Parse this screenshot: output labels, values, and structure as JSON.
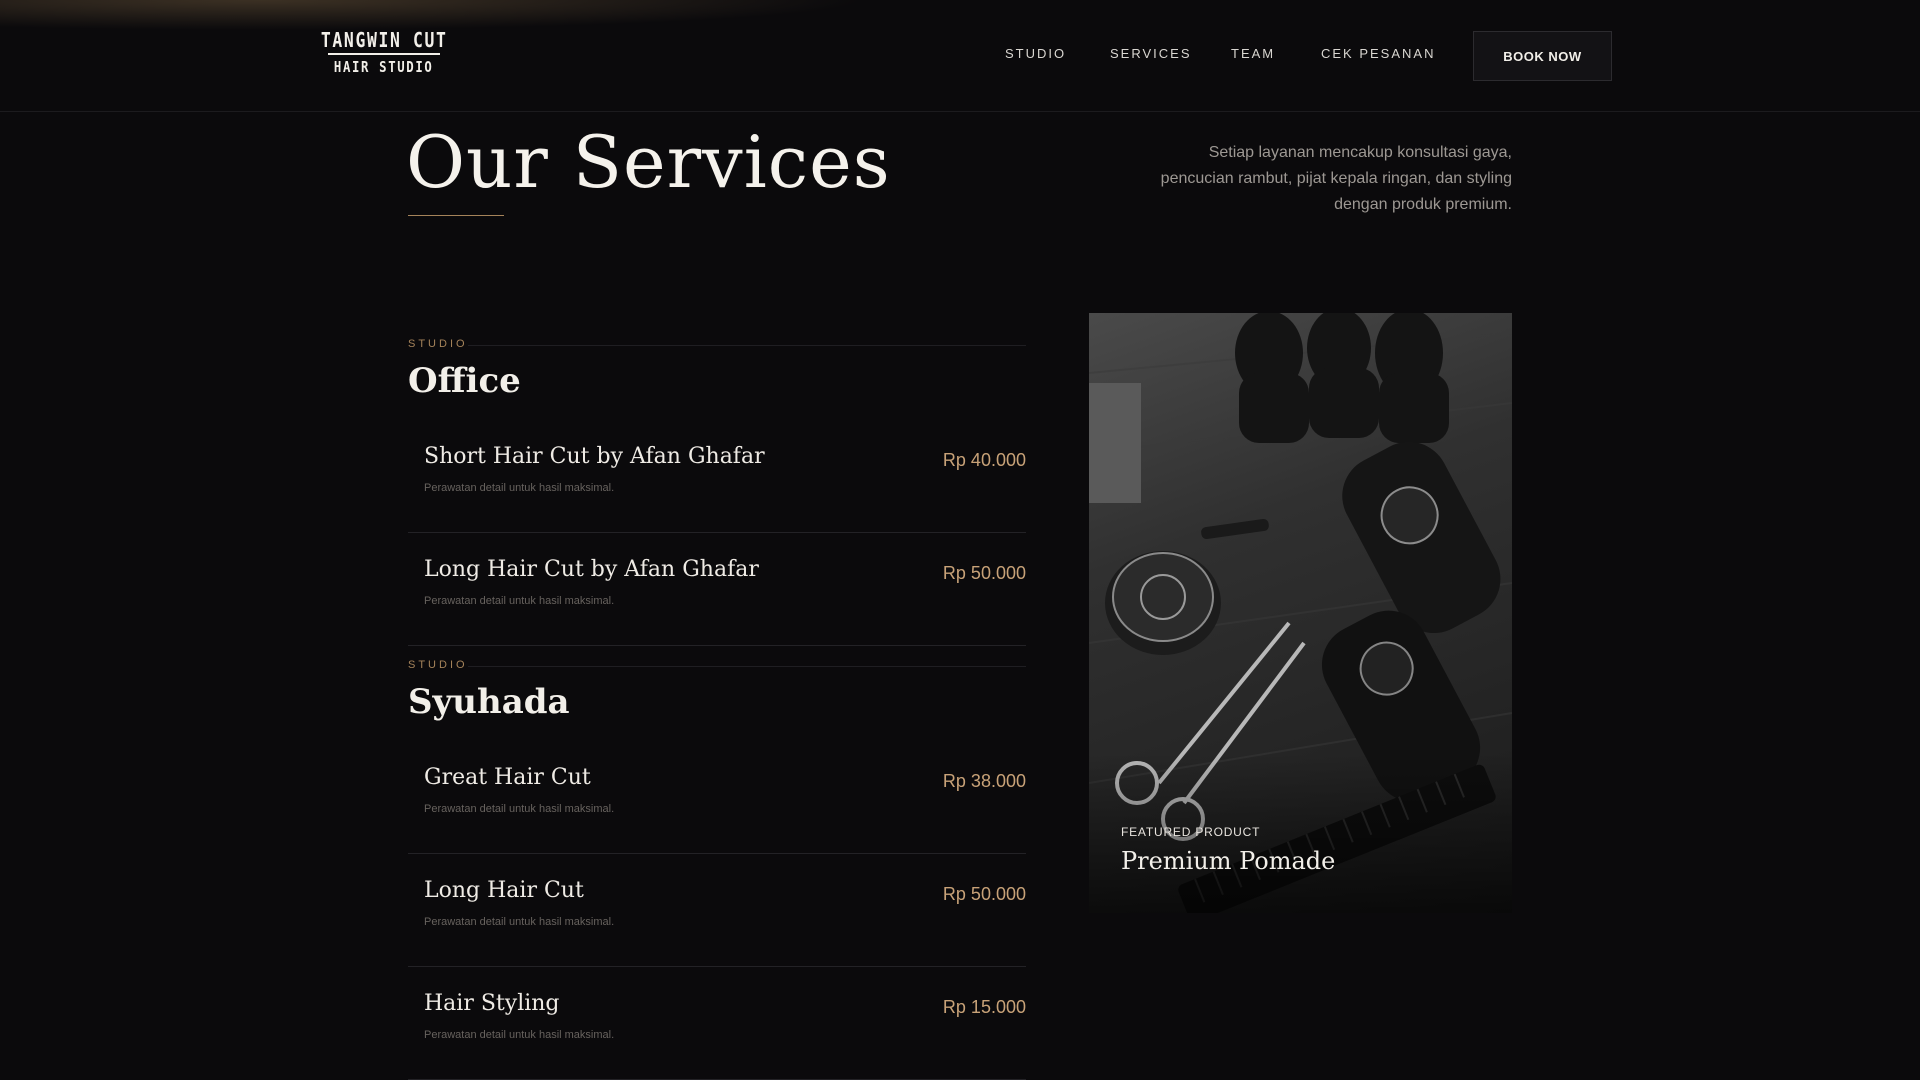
{
  "brand": {
    "line1": "TANGWIN CUT",
    "line2": "HAIR STUDIO"
  },
  "nav": {
    "items": [
      "STUDIO",
      "SERVICES",
      "TEAM",
      "CEK PESANAN"
    ],
    "cta": "BOOK NOW"
  },
  "hero": {
    "title": "Our Services",
    "intro_lines": [
      "Setiap layanan mencakup konsultasi gaya,",
      "pencucian rambut, pijat kepala ringan, dan styling",
      "dengan produk premium."
    ]
  },
  "groups": [
    {
      "kicker": "STUDIO",
      "title": "Office",
      "services": [
        {
          "name": "Short Hair Cut by Afan Ghafar",
          "desc": "Perawatan detail untuk hasil maksimal.",
          "price": "Rp 40.000"
        },
        {
          "name": "Long Hair Cut by Afan Ghafar",
          "desc": "Perawatan detail untuk hasil maksimal.",
          "price": "Rp 50.000"
        }
      ]
    },
    {
      "kicker": "STUDIO",
      "title": "Syuhada",
      "services": [
        {
          "name": "Great Hair Cut",
          "desc": "Perawatan detail untuk hasil maksimal.",
          "price": "Rp 38.000"
        },
        {
          "name": "Long Hair Cut",
          "desc": "Perawatan detail untuk hasil maksimal.",
          "price": "Rp 50.000"
        },
        {
          "name": "Hair Styling",
          "desc": "Perawatan detail untuk hasil maksimal.",
          "price": "Rp 15.000"
        }
      ]
    }
  ],
  "featured": {
    "kicker": "FEATURED PRODUCT",
    "title": "Premium Pomade",
    "image_subject": "barber-tools-photo"
  },
  "colors": {
    "background": "#0b0a0c",
    "accent": "#c8a278",
    "text": "#efebe5",
    "muted": "#9d9893"
  }
}
